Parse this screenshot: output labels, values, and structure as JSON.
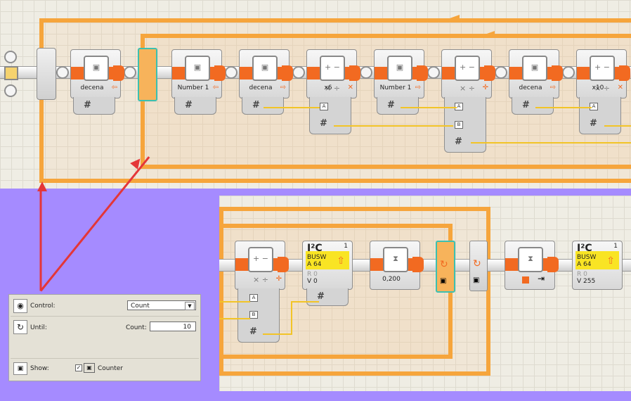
{
  "top_sequence": {
    "blocks": [
      {
        "label": "decena",
        "kind": "variable"
      },
      {
        "label": "Number 1",
        "kind": "variable"
      },
      {
        "label": "decena",
        "kind": "variable"
      },
      {
        "label": "x6",
        "kind": "math"
      },
      {
        "label": "Number 1",
        "kind": "variable"
      },
      {
        "label": "",
        "kind": "math"
      },
      {
        "label": "decena",
        "kind": "variable"
      },
      {
        "label": "x10",
        "kind": "math"
      }
    ],
    "plug_a": "A",
    "plug_b": "B",
    "hash": "#"
  },
  "bottom_sequence": {
    "i2c_1": {
      "title": "I²C",
      "bus": "BUSW",
      "num": "1",
      "addr": "A 64",
      "r": "R 0",
      "v": "V 0"
    },
    "wait_label": "0,200",
    "i2c_2": {
      "title": "I²C",
      "bus": "BUSW",
      "num": "1",
      "addr": "A 64",
      "r": "R 0",
      "v": "V 255"
    }
  },
  "panel": {
    "control_label": "Control:",
    "control_value": "Count",
    "until_label": "Until:",
    "count_label": "Count:",
    "count_value": "10",
    "show_label": "Show:",
    "counter_label": "Counter"
  },
  "colors": {
    "accent": "#f26a21",
    "loop": "#f6a53c",
    "wire": "#f2c427",
    "arrow": "#e43638",
    "background": "#a58bff"
  }
}
